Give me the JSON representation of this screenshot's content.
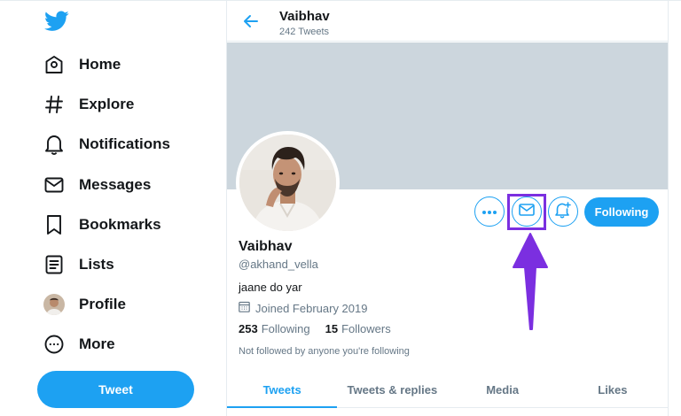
{
  "sidebar": {
    "items": [
      {
        "label": "Home"
      },
      {
        "label": "Explore"
      },
      {
        "label": "Notifications"
      },
      {
        "label": "Messages"
      },
      {
        "label": "Bookmarks"
      },
      {
        "label": "Lists"
      },
      {
        "label": "Profile"
      },
      {
        "label": "More"
      }
    ],
    "tweet_button": "Tweet"
  },
  "header": {
    "name": "Vaibhav",
    "tweet_count": "242 Tweets"
  },
  "profile": {
    "name": "Vaibhav",
    "handle": "@akhand_vella",
    "bio": "jaane do yar",
    "joined": "Joined February 2019",
    "following_count": "253",
    "following_label": "Following",
    "followers_count": "15",
    "followers_label": "Followers",
    "not_followed_text": "Not followed by anyone you're following",
    "following_button": "Following"
  },
  "tabs": [
    {
      "label": "Tweets",
      "active": true
    },
    {
      "label": "Tweets & replies",
      "active": false
    },
    {
      "label": "Media",
      "active": false
    },
    {
      "label": "Likes",
      "active": false
    }
  ],
  "colors": {
    "accent": "#1da1f2",
    "highlight": "#7b2fe0",
    "banner": "#ccd6dd"
  },
  "icons": {
    "logo": "twitter-bird-icon",
    "more_options": "ellipsis-icon",
    "message": "envelope-icon",
    "notify": "bell-plus-icon",
    "back": "arrow-left-icon",
    "calendar": "calendar-icon"
  }
}
